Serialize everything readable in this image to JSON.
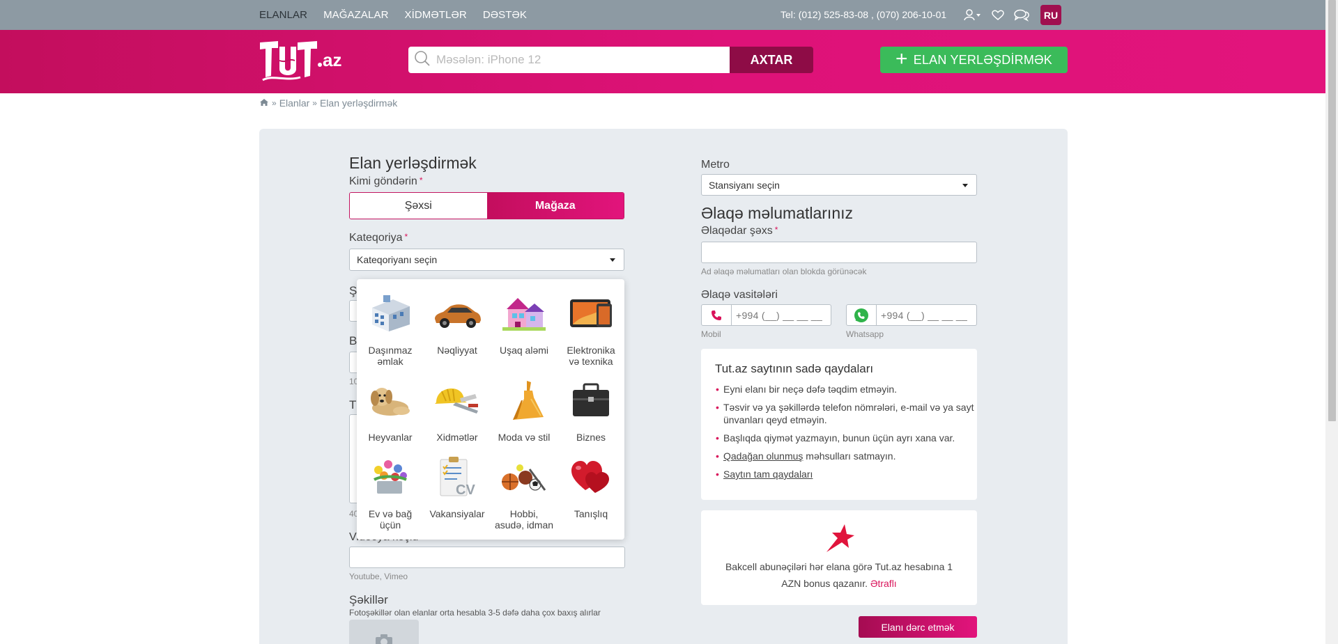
{
  "topbar": {
    "nav": [
      "ELANLAR",
      "MAĞAZALAR",
      "XİDMƏTLƏR",
      "DƏSTƏK"
    ],
    "phone": "Tel: (012) 525-83-08 , (070) 206-10-01",
    "lang": "RU"
  },
  "header": {
    "logo_text": "TUT.az",
    "search_placeholder": "Məsələn: iPhone 12",
    "search_button": "AXTAR",
    "post_button": "ELAN YERLƏŞDİRMƏK"
  },
  "breadcrumb": [
    "Elanlar",
    "Elan yerləşdirmək"
  ],
  "form": {
    "title": "Elan yerləşdirmək",
    "sender_label": "Kimi göndərin",
    "sender_options": [
      "Şəxsi",
      "Mağaza"
    ],
    "sender_selected": "Mağaza",
    "category_label": "Kateqoriya",
    "category_value": "Kateqoriyanı seçin",
    "video_label": "Videoya keçid",
    "video_hint": "Youtube, Vimeo",
    "photos_label": "Şəkillər",
    "photos_hint": "Fotoşəkillər olan elanlar orta hesabla 3-5 dəfə daha çox baxış alırlar",
    "hidden_letters": [
      "Ş",
      "B",
      "T"
    ],
    "hidden_hints": [
      "10",
      "40"
    ]
  },
  "categories": [
    {
      "name": "Daşınmaz əmlak",
      "icon": "building-icon"
    },
    {
      "name": "Nəqliyyat",
      "icon": "car-icon"
    },
    {
      "name": "Uşaq aləmi",
      "icon": "dollhouse-icon"
    },
    {
      "name": "Elektronika və texnika",
      "icon": "tablet-icon"
    },
    {
      "name": "Heyvanlar",
      "icon": "puppy-icon"
    },
    {
      "name": "Xidmətlər",
      "icon": "tools-icon"
    },
    {
      "name": "Moda və stil",
      "icon": "dress-icon"
    },
    {
      "name": "Biznes",
      "icon": "briefcase-icon"
    },
    {
      "name": "Ev və bağ üçün",
      "icon": "flowers-icon"
    },
    {
      "name": "Vakansiyalar",
      "icon": "cv-icon"
    },
    {
      "name": "Hobbi, asudə, idman",
      "icon": "sports-balls-icon"
    },
    {
      "name": "Tanışlıq",
      "icon": "hearts-icon"
    }
  ],
  "right": {
    "metro_label": "Metro",
    "metro_value": "Stansiyanı seçin",
    "contacts_title": "Əlaqə məlumatlarınız",
    "contact_person_label": "Əlaqədar şəxs",
    "contact_person_hint": "Ad əlaqə məlumatları olan blokda görünəcək",
    "contact_means_label": "Əlaqə vasitələri",
    "mobile_placeholder": "+994 (__) __ __ __",
    "mobile_label": "Mobil",
    "whatsapp_placeholder": "+994 (__) __ __ __",
    "whatsapp_label": "Whatsapp"
  },
  "rules": {
    "title": "Tut.az saytının sadə qaydaları",
    "items": [
      "Eyni elanı bir neçə dəfə təqdim etməyin.",
      "Təsvir və ya şəkillərdə telefon nömrələri, e-mail və ya sayt ünvanları qeyd etməyin.",
      "Başlıqda qiymət yazmayın, bunun üçün ayrı xana var."
    ],
    "forbidden_link": "Qadağan olunmuş",
    "forbidden_rest": " məhsulları satmayın.",
    "full_rules_link": "Saytın tam qaydaları"
  },
  "bonus": {
    "text": "Bakcell abunəçiləri hər elana görə Tut.az hesabına 1 AZN bonus qazanır.",
    "more": "Ətraflı"
  },
  "submit_label": "Elanı dərc etmək",
  "colors": {
    "brand_pink": "#e2147c",
    "brand_dark": "#8e0c46",
    "green": "#3bbb5a",
    "topbar": "#8d9aa3",
    "panel": "#e8ecf0"
  }
}
